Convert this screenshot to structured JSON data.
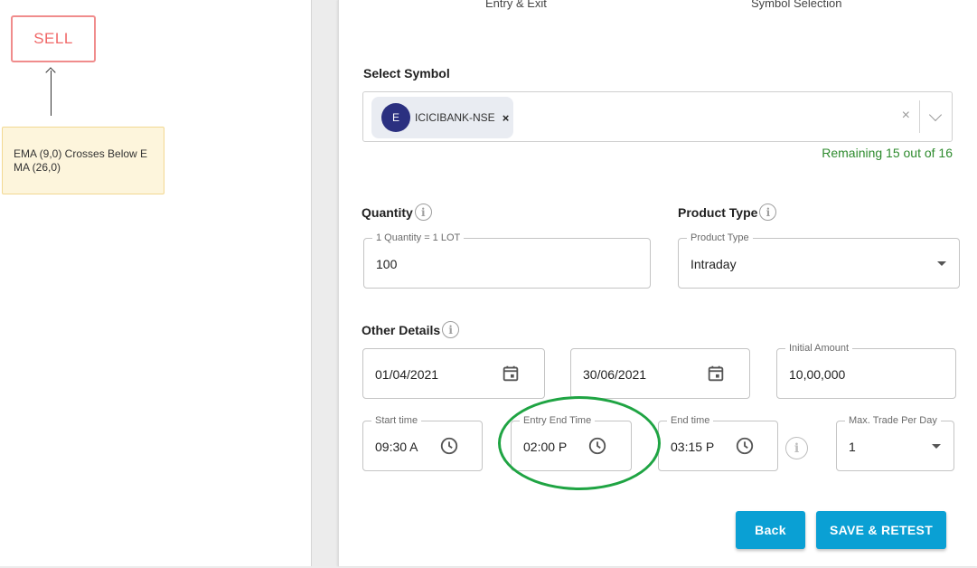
{
  "canvas": {
    "sell_label": "SELL",
    "condition_text": "EMA (9,0) Crosses Below EMA (26,0)"
  },
  "tabs": {
    "entry_exit": "Entry & Exit",
    "symbol_selection": "Symbol Selection"
  },
  "symbol": {
    "label": "Select Symbol",
    "chip_avatar": "E",
    "chip_label": "ICICIBANK-NSE",
    "chip_remove": "×",
    "clear": "×",
    "remaining": "Remaining 15 out of 16"
  },
  "quantity": {
    "label": "Quantity",
    "legend": "1 Quantity = 1 LOT",
    "value": "100"
  },
  "product_type": {
    "label": "Product Type",
    "legend": "Product Type",
    "value": "Intraday"
  },
  "other_details": {
    "label": "Other Details",
    "start_date": "01/04/2021",
    "end_date": "30/06/2021",
    "initial_amount_legend": "Initial Amount",
    "initial_amount": "10,00,000",
    "start_time_legend": "Start time",
    "start_time": "09:30 A",
    "entry_end_time_legend": "Entry End Time",
    "entry_end_time": "02:00 P",
    "end_time_legend": "End time",
    "end_time": "03:15 P",
    "max_trade_legend": "Max. Trade Per Day",
    "max_trade": "1"
  },
  "info_glyph": "i",
  "actions": {
    "back": "Back",
    "save_retest": "SAVE & RETEST"
  },
  "colors": {
    "primary": "#0aa0d4",
    "sell": "#f06868",
    "success": "#2e8b2e",
    "highlight": "#1fa443"
  }
}
